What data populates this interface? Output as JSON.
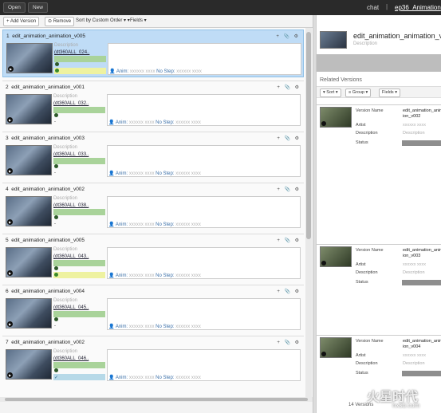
{
  "topbar": {
    "open": "Open",
    "new": "New",
    "chat": "chat",
    "sep": "|",
    "project": "ep36_Animation"
  },
  "toolbar": {
    "add": "+ Add Version",
    "remove": "⊝ Remove",
    "sort": "Sort by Custom Order ▾ ▾",
    "fields": "Fields ▾"
  },
  "items": [
    {
      "num": "1",
      "name": "edit_animation_animation_v005",
      "desc": "Description",
      "shot": "(dt360ALL_024..",
      "bottom": "yellow",
      "note_prefix": "Anim:",
      "note_user": "xxxxxx xxxx",
      "note_step": "No Step:",
      "note_step_val": "xxxxxx xxxx"
    },
    {
      "num": "2",
      "name": "edit_animation_animation_v001",
      "desc": "Description",
      "shot": "(dt360ALL_032..",
      "bottom": "dash",
      "note_prefix": "Anim:",
      "note_user": "xxxxxx xxxx",
      "note_step": "No Step:",
      "note_step_val": "xxxxxx xxxx"
    },
    {
      "num": "3",
      "name": "edit_animation_animation_v003",
      "desc": "Description",
      "shot": "(dt360ALL_033..",
      "bottom": "dash",
      "note_prefix": "Anim:",
      "note_user": "xxxxxx xxxx",
      "note_step": "No Step:",
      "note_step_val": "xxxxxx xxxx"
    },
    {
      "num": "4",
      "name": "edit_animation_animation_v002",
      "desc": "Description",
      "shot": "(dt360ALL_038..",
      "bottom": "dash",
      "note_prefix": "Anim:",
      "note_user": "xxxxxx xxxx",
      "note_step": "No Step:",
      "note_step_val": "xxxxxx xxxx"
    },
    {
      "num": "5",
      "name": "edit_animation_animation_v005",
      "desc": "Description",
      "shot": "(dt360ALL_043..",
      "bottom": "yellow",
      "note_prefix": "Anim:",
      "note_user": "xxxxxx xxxx",
      "note_step": "No Step:",
      "note_step_val": "xxxxxx xxxx"
    },
    {
      "num": "6",
      "name": "edit_animation_animation_v004",
      "desc": "Description",
      "shot": "(dt360ALL_045..",
      "bottom": "dash",
      "note_prefix": "Anim:",
      "note_user": "xxxxxx xxxx",
      "note_step": "No Step:",
      "note_step_val": "xxxxxx xxxx"
    },
    {
      "num": "7",
      "name": "edit_animation_animation_v002",
      "desc": "Description",
      "shot": "(dt360ALL_046..",
      "bottom": "teal",
      "note_prefix": "Anim:",
      "note_user": "xxxxxx xxxx",
      "note_step": "No Step:",
      "note_step_val": "xxxxxx xxxx"
    }
  ],
  "detail": {
    "title": "edit_animation_animation_v",
    "desc": "Description",
    "related_header": "Related Versions",
    "tools": {
      "sort": "▾ Sort ▾",
      "group": "≡ Group ▾",
      "fields": "Fields ▾"
    },
    "labels": {
      "version_name": "Version Name",
      "artist": "Artist",
      "description": "Description",
      "status": "Status"
    },
    "related": [
      {
        "name": "edit_animation_animat ion_v002",
        "artist": "xxxxxx xxxx",
        "description": "Description"
      },
      {
        "name": "edit_animation_animat ion_v003",
        "artist": "xxxxxx xxxx",
        "description": "Description"
      },
      {
        "name": "edit_animation_animat ion_v004",
        "artist": "xxxxxx xxxx",
        "description": "Description"
      }
    ],
    "footer": "14 Versions"
  },
  "watermark": {
    "text": "火星时代",
    "sub": "hxsd.com"
  },
  "colors": {
    "selected": "#bfdcf6",
    "green": "#a9d39a",
    "yellow": "#eef2a0",
    "topbar": "#2a2a2a"
  }
}
